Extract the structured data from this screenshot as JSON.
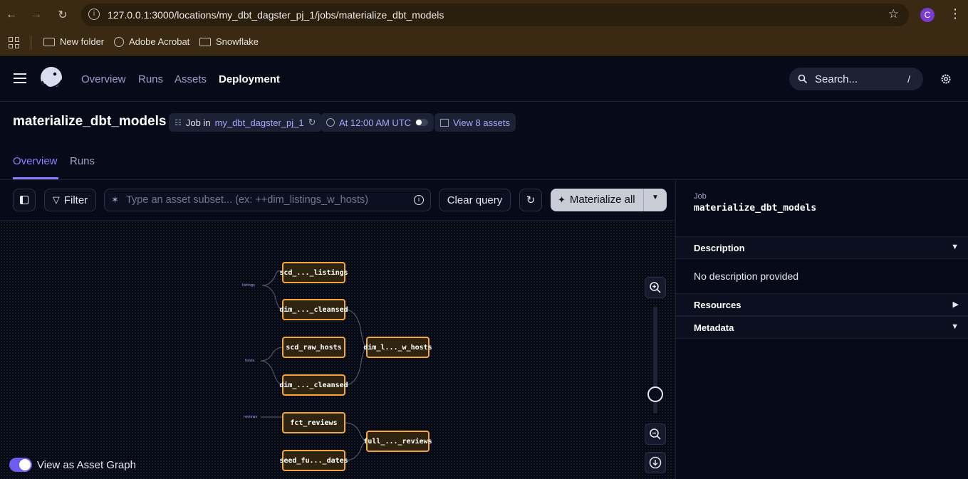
{
  "browser": {
    "url": "127.0.0.1:3000/locations/my_dbt_dagster_pj_1/jobs/materialize_dbt_models",
    "profile_initial": "C",
    "bookmarks": [
      "New folder",
      "Adobe Acrobat",
      "Snowflake"
    ]
  },
  "nav": {
    "items": [
      "Overview",
      "Runs",
      "Assets",
      "Deployment"
    ],
    "active": "Deployment",
    "search_placeholder": "Search...",
    "search_shortcut": "/"
  },
  "job": {
    "title": "materialize_dbt_models",
    "job_in_prefix": "Job in",
    "location": "my_dbt_dagster_pj_1",
    "schedule": "At 12:00 AM UTC",
    "view_assets": "View 8 assets"
  },
  "tabs": [
    "Overview",
    "Runs"
  ],
  "toolbar": {
    "filter_label": "Filter",
    "query_placeholder": "Type an asset subset... (ex: ++dim_listings_w_hosts)",
    "clear_label": "Clear query",
    "materialize_label": "Materialize all"
  },
  "graph": {
    "groups": [
      "listings",
      "hosts",
      "reviews"
    ],
    "nodes": [
      "scd_..._listings",
      "dim_..._cleansed",
      "scd_raw_hosts",
      "dim_..._cleansed",
      "dim_l..._w_hosts",
      "fct_reviews",
      "full_..._reviews",
      "seed_fu..._dates"
    ],
    "toggle_label": "View as Asset Graph",
    "toggle_on": true
  },
  "side_panel": {
    "kind": "Job",
    "title": "materialize_dbt_models",
    "sections": [
      "Description",
      "Resources",
      "Metadata"
    ],
    "description": "No description provided"
  },
  "colors": {
    "accent": "#8b7dff",
    "node_border": "#f4a73d",
    "browser_bar": "#3a2a14"
  }
}
